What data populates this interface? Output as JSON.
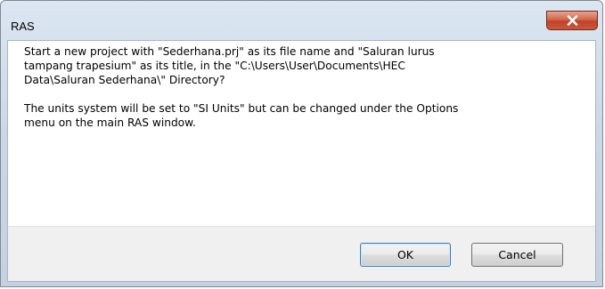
{
  "window": {
    "title": "RAS",
    "close_icon": "close-icon"
  },
  "message": {
    "paragraph1": "Start a new project with \"Sederhana.prj\" as its file name and \"Saluran lurus\ntampang trapesium\" as its title, in the \"C:\\Users\\User\\Documents\\HEC\nData\\Saluran Sederhana\\\" Directory?",
    "paragraph2": "The units system will be set to \"SI Units\" but can be changed under the Options\nmenu on the main RAS window."
  },
  "buttons": {
    "ok_label": "OK",
    "cancel_label": "Cancel"
  },
  "colors": {
    "title_bar": "#cbd8e6",
    "close_button": "#c9573c",
    "footer": "#f0f0f0",
    "default_button_border": "#3c7fb1"
  }
}
